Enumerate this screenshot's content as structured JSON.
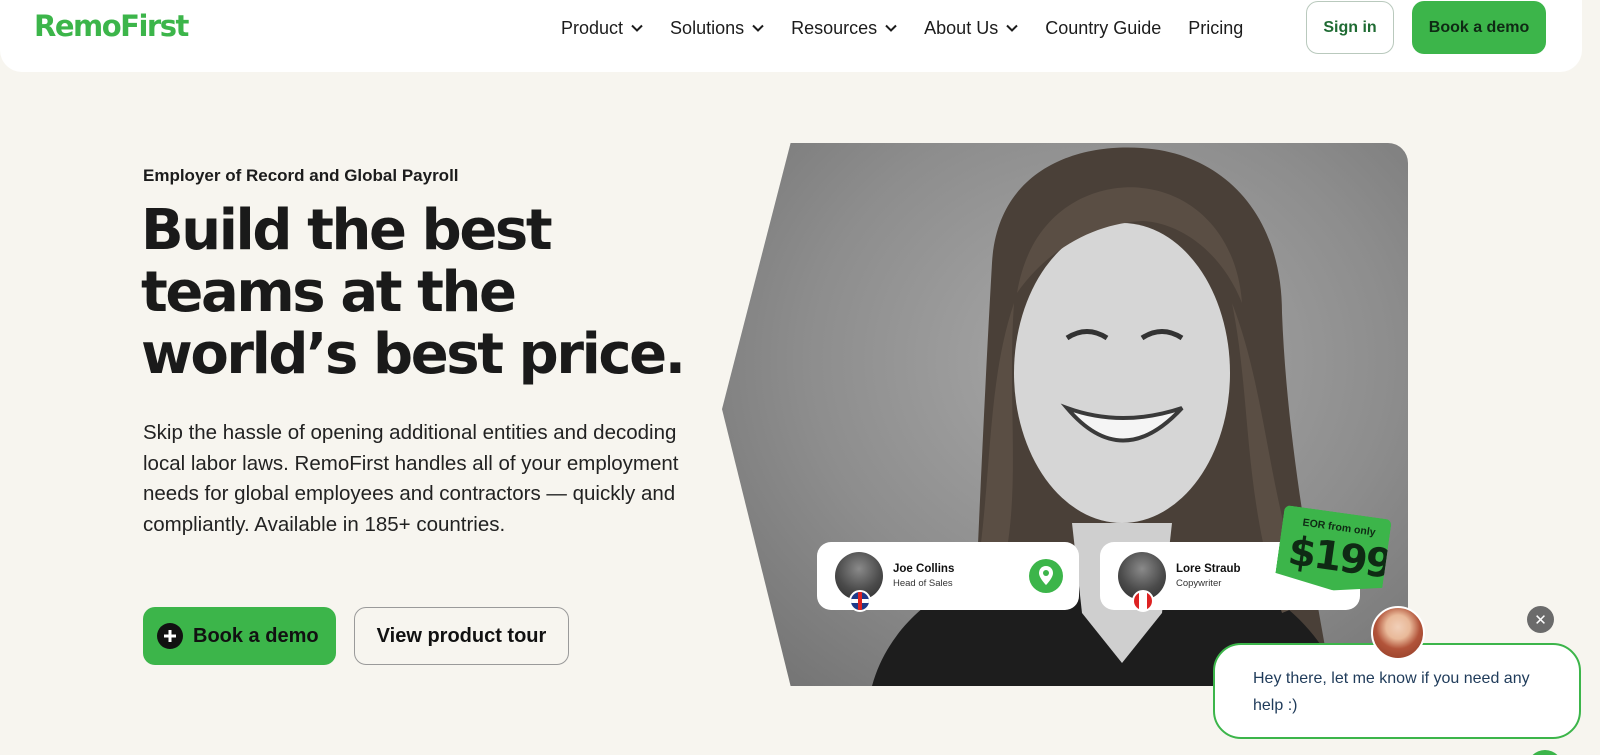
{
  "brand": {
    "name": "RemoFirst",
    "accent": "#3cb54a"
  },
  "nav": {
    "items": [
      {
        "label": "Product",
        "dropdown": true
      },
      {
        "label": "Solutions",
        "dropdown": true
      },
      {
        "label": "Resources",
        "dropdown": true
      },
      {
        "label": "About Us",
        "dropdown": true
      },
      {
        "label": "Country Guide",
        "dropdown": false
      },
      {
        "label": "Pricing",
        "dropdown": false
      }
    ],
    "signin_label": "Sign in",
    "demo_label": "Book a demo"
  },
  "hero": {
    "eyebrow": "Employer of Record and Global Payroll",
    "headline": "Build the best teams at the world’s best price.",
    "description": "Skip the hassle of opening additional entities and decoding local labor laws. RemoFirst handles all of your employment needs for global employees and contractors — quickly and compliantly. Available in 185+ countries.",
    "cta_primary": "Book a demo",
    "cta_secondary": "View product tour"
  },
  "cards": [
    {
      "name": "Joe Collins",
      "role": "Head of Sales",
      "flag": "uk-flag-icon"
    },
    {
      "name": "Lore Straub",
      "role": "Copywriter",
      "flag": "canada-flag-icon"
    }
  ],
  "price_badge": {
    "prefix": "EOR from only",
    "amount": "$199"
  },
  "chat": {
    "message": "Hey there, let me know if you need any help :)",
    "close_symbol": "✕"
  }
}
